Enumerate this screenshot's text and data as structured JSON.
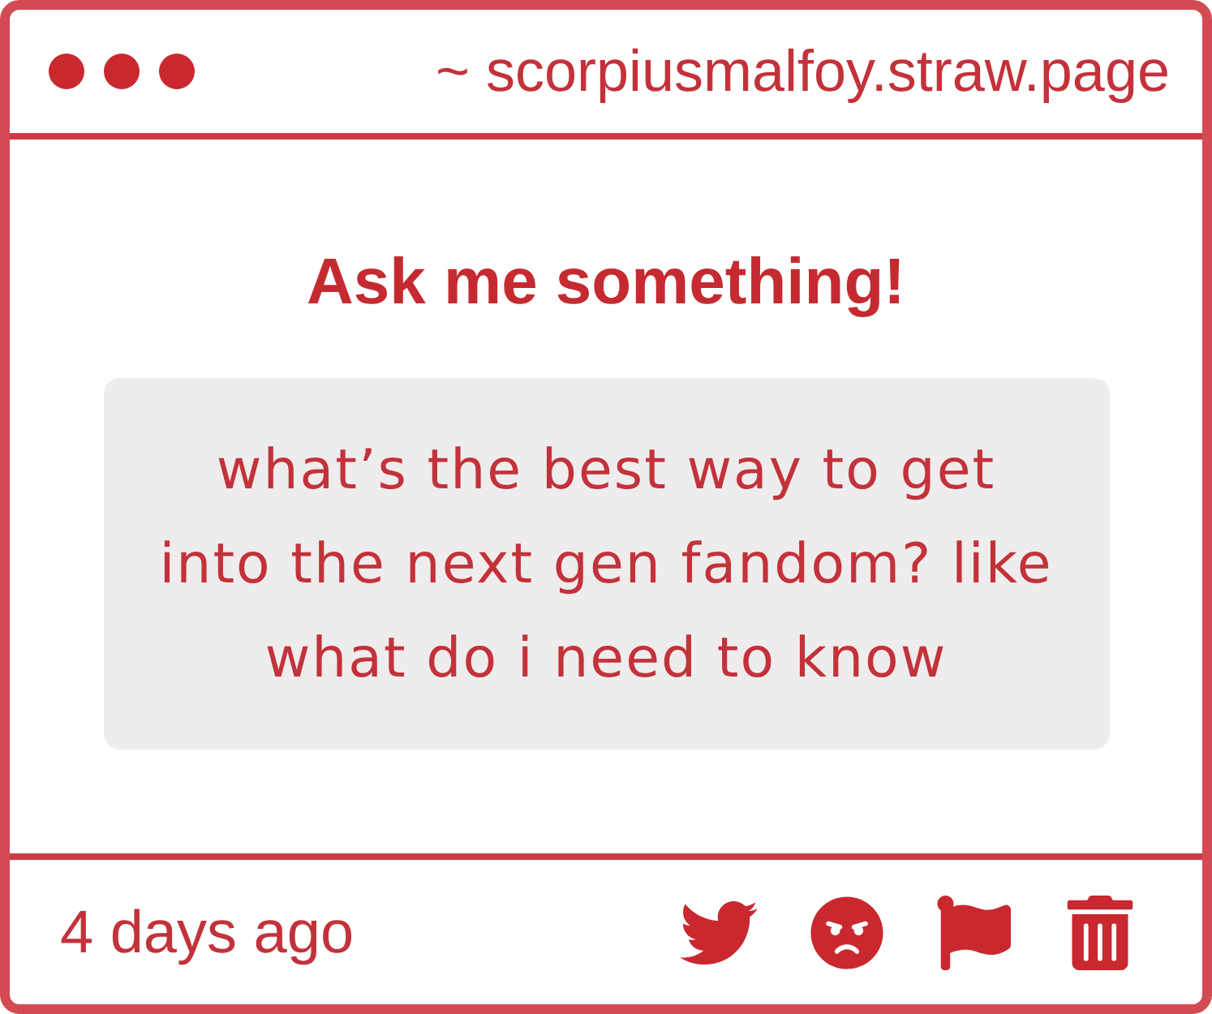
{
  "window": {
    "address": "~ scorpiusmalfoy.straw.page"
  },
  "card": {
    "title": "Ask me something!",
    "question": "what’s the best way to get into the next gen fandom? like what do i need to know"
  },
  "footer": {
    "timestamp": "4 days ago"
  }
}
